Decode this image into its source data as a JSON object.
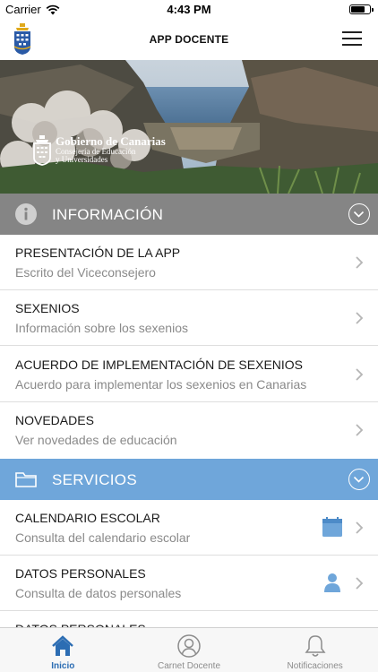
{
  "status_bar": {
    "carrier": "Carrier",
    "time": "4:43 PM",
    "battery_level": 0.75
  },
  "header": {
    "title": "APP DOCENTE",
    "menu_icon": "hamburger-menu-icon",
    "load_progress": 0.37
  },
  "hero": {
    "brand_name": "Gobierno de Canarias",
    "brand_line1": "Consejería de Educación",
    "brand_line2": "y Universidades"
  },
  "sections": {
    "info": {
      "label": "INFORMACIÓN",
      "icon": "info-icon",
      "color": "#858585"
    },
    "services": {
      "label": "SERVICIOS",
      "icon": "folder-icon",
      "color": "#6fa6da"
    }
  },
  "info_items": [
    {
      "title": "PRESENTACIÓN DE LA APP",
      "subtitle": "Escrito del Viceconsejero"
    },
    {
      "title": "SEXENIOS",
      "subtitle": "Información sobre los sexenios"
    },
    {
      "title": "ACUERDO DE IMPLEMENTACIÓN DE SEXENIOS",
      "subtitle": "Acuerdo para implementar los sexenios en Canarias"
    },
    {
      "title": "NOVEDADES",
      "subtitle": "Ver novedades de educación"
    }
  ],
  "service_items": [
    {
      "title": "CALENDARIO ESCOLAR",
      "subtitle": "Consulta del calendario escolar",
      "icon": "calendar-icon"
    },
    {
      "title": "DATOS PERSONALES",
      "subtitle": "Consulta de datos personales",
      "icon": "user-icon"
    },
    {
      "title": "DATOS PERSONALES",
      "subtitle": ""
    }
  ],
  "tabs": [
    {
      "label": "Inicio",
      "icon": "home-icon",
      "active": true
    },
    {
      "label": "Carnet Docente",
      "icon": "user-circle-icon",
      "active": false
    },
    {
      "label": "Notificaciones",
      "icon": "bell-icon",
      "active": false
    }
  ],
  "colors": {
    "accent": "#2c6db3",
    "progress": "#3b7fc4",
    "row_icon": "#6fa6da"
  }
}
